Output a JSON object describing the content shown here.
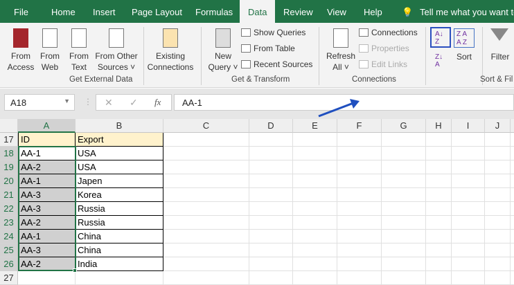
{
  "tabs": [
    "File",
    "Home",
    "Insert",
    "Page Layout",
    "Formulas",
    "Data",
    "Review",
    "View",
    "Help"
  ],
  "active_tab": "Data",
  "tell_me": "Tell me what you want to",
  "ribbon": {
    "get_external": {
      "label": "Get External Data",
      "from_access": [
        "From",
        "Access"
      ],
      "from_web": [
        "From",
        "Web"
      ],
      "from_text": [
        "From",
        "Text"
      ],
      "from_other": [
        "From Other",
        "Sources ˅"
      ],
      "existing": [
        "Existing",
        "Connections"
      ]
    },
    "get_transform": {
      "label": "Get & Transform",
      "new_query": [
        "New",
        "Query ˅"
      ],
      "show_queries": "Show Queries",
      "from_table": "From Table",
      "recent_sources": "Recent Sources"
    },
    "connections": {
      "label": "Connections",
      "refresh": [
        "Refresh",
        "All ˅"
      ],
      "connections": "Connections",
      "properties": "Properties",
      "edit_links": "Edit Links"
    },
    "sort_filter": {
      "label": "Sort & Fil",
      "sort": "Sort",
      "filter": "Filter"
    }
  },
  "name_box": "A18",
  "formula": "AA-1",
  "columns": [
    "A",
    "B",
    "C",
    "D",
    "E",
    "F",
    "G",
    "H",
    "I",
    "J"
  ],
  "rows": [
    {
      "n": "17",
      "a": "ID",
      "b": "Export"
    },
    {
      "n": "18",
      "a": "AA-1",
      "b": "USA"
    },
    {
      "n": "19",
      "a": "AA-2",
      "b": "USA"
    },
    {
      "n": "20",
      "a": "AA-1",
      "b": "Japen"
    },
    {
      "n": "21",
      "a": "AA-3",
      "b": "Korea"
    },
    {
      "n": "22",
      "a": "AA-3",
      "b": "Russia"
    },
    {
      "n": "23",
      "a": "AA-2",
      "b": "Russia"
    },
    {
      "n": "24",
      "a": "AA-1",
      "b": "China"
    },
    {
      "n": "25",
      "a": "AA-3",
      "b": "China"
    },
    {
      "n": "26",
      "a": "AA-2",
      "b": "India"
    },
    {
      "n": "27",
      "a": "",
      "b": ""
    }
  ],
  "colors": {
    "excel_green": "#217346",
    "header_fill": "#fff2cc",
    "arrow": "#1f4fbf"
  }
}
